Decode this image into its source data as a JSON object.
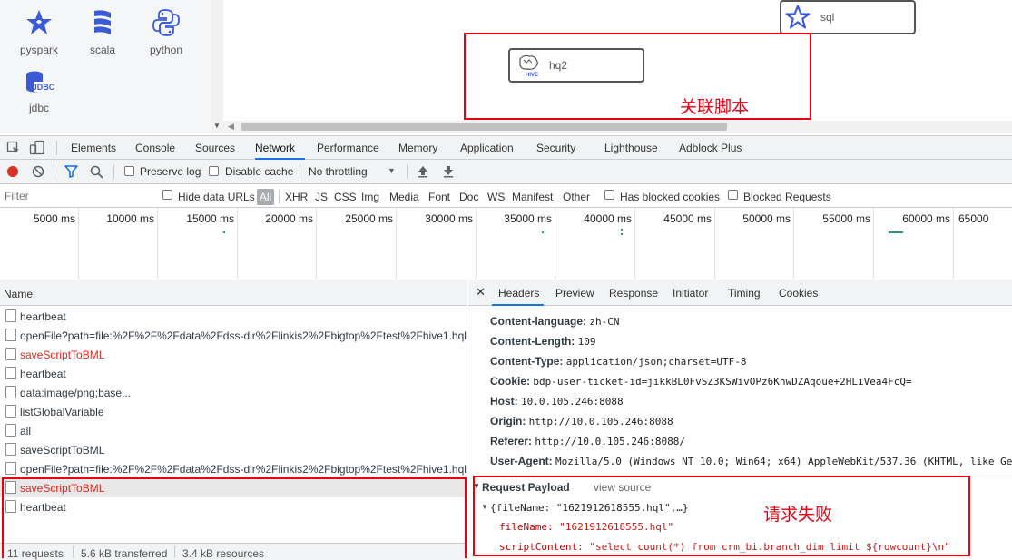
{
  "palette": {
    "items": [
      {
        "label": "pyspark"
      },
      {
        "label": "scala"
      },
      {
        "label": "python"
      },
      {
        "label": "jdbc"
      }
    ],
    "jdbc_icon_text": "JDBC"
  },
  "canvas": {
    "nodes": {
      "sql": "sql",
      "hq2": "hq2"
    },
    "hive_icon_text": "HIVE",
    "annotation_top": "关联脚本"
  },
  "devtools": {
    "tabs": [
      "Elements",
      "Console",
      "Sources",
      "Network",
      "Performance",
      "Memory",
      "Application",
      "Security",
      "Lighthouse",
      "Adblock Plus"
    ],
    "active_tab": "Network",
    "toolbar": {
      "preserve_log": "Preserve log",
      "disable_cache": "Disable cache",
      "throttling": "No throttling"
    },
    "filter": {
      "placeholder": "Filter",
      "hide_data_urls": "Hide data URLs",
      "types": [
        "All",
        "XHR",
        "JS",
        "CSS",
        "Img",
        "Media",
        "Font",
        "Doc",
        "WS",
        "Manifest",
        "Other"
      ],
      "has_blocked_cookies": "Has blocked cookies",
      "blocked_requests": "Blocked Requests"
    },
    "timeline": [
      "5000 ms",
      "10000 ms",
      "15000 ms",
      "20000 ms",
      "25000 ms",
      "30000 ms",
      "35000 ms",
      "40000 ms",
      "45000 ms",
      "50000 ms",
      "55000 ms",
      "60000 ms",
      "65000"
    ],
    "requests": {
      "column": "Name",
      "rows": [
        {
          "name": "heartbeat",
          "error": false
        },
        {
          "name": "openFile?path=file:%2F%2F%2Fdata%2Fdss-dir%2Flinkis2%2Fbigtop%2Ftest%2Fhive1.hql",
          "error": false
        },
        {
          "name": "saveScriptToBML",
          "error": true
        },
        {
          "name": "heartbeat",
          "error": false
        },
        {
          "name": "data:image/png;base...",
          "error": false
        },
        {
          "name": "listGlobalVariable",
          "error": false
        },
        {
          "name": "all",
          "error": false
        },
        {
          "name": "saveScriptToBML",
          "error": false
        },
        {
          "name": "openFile?path=file:%2F%2F%2Fdata%2Fdss-dir%2Flinkis2%2Fbigtop%2Ftest%2Fhive1.hql",
          "error": false
        },
        {
          "name": "saveScriptToBML",
          "error": true
        },
        {
          "name": "heartbeat",
          "error": false
        }
      ],
      "status": [
        "11 requests",
        "5.6 kB transferred",
        "3.4 kB resources"
      ]
    },
    "details": {
      "tabs": [
        "Headers",
        "Preview",
        "Response",
        "Initiator",
        "Timing",
        "Cookies"
      ],
      "active_tab": "Headers",
      "headers": [
        {
          "k": "Content-language:",
          "v": "zh-CN"
        },
        {
          "k": "Content-Length:",
          "v": "109"
        },
        {
          "k": "Content-Type:",
          "v": "application/json;charset=UTF-8"
        },
        {
          "k": "Cookie:",
          "v": "bdp-user-ticket-id=jikkBL0FvSZ3KSWivOPz6KhwDZAqoue+2HLiVea4FcQ="
        },
        {
          "k": "Host:",
          "v": "10.0.105.246:8088"
        },
        {
          "k": "Origin:",
          "v": "http://10.0.105.246:8088"
        },
        {
          "k": "Referer:",
          "v": "http://10.0.105.246:8088/"
        },
        {
          "k": "User-Agent:",
          "v": "Mozilla/5.0 (Windows NT 10.0; Win64; x64) AppleWebKit/537.36 (KHTML, like Ge"
        }
      ],
      "payload": {
        "title": "Request Payload",
        "view_source": "view source",
        "summary": "{fileName: \"1621912618555.hql\",…}",
        "fields": [
          {
            "k": "fileName:",
            "v": "\"1621912618555.hql\""
          },
          {
            "k": "scriptContent:",
            "v": "\"select count(*) from crm_bi.branch_dim limit ${rowcount}\\n\""
          }
        ]
      },
      "annotation": "请求失败"
    }
  },
  "colors": {
    "accent": "#1a73e8",
    "error": "#e0281b",
    "annotation": "#e60012",
    "icon_blue": "#3b5bd6"
  }
}
